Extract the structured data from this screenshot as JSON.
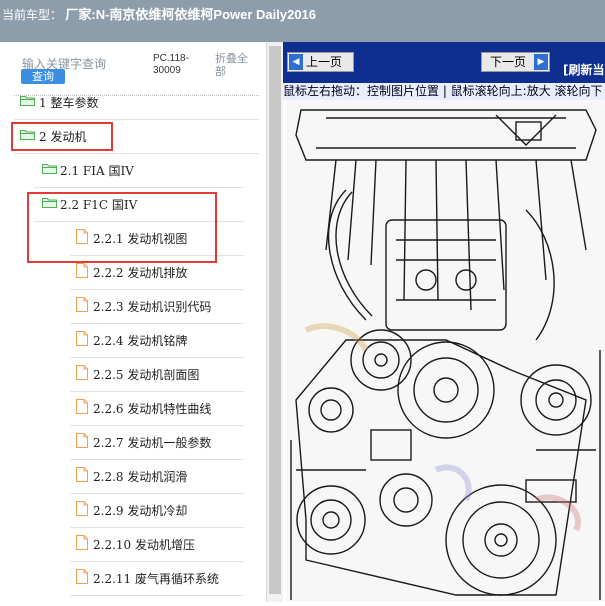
{
  "header": {
    "label": "当前车型：",
    "vehicle": "厂家:N-南京依维柯依维柯Power Daily2016"
  },
  "sidebar": {
    "search": {
      "label": "输入关键字查询",
      "button": "查询"
    },
    "pc_code": "PC.118-30009",
    "collapse_all": "折叠全部",
    "items": [
      {
        "label": "1 整车参数",
        "icon": "folder-open-icon"
      },
      {
        "label": "2 发动机",
        "icon": "folder-open-icon"
      },
      {
        "label": "2.1 FIA 国IV",
        "icon": "folder-open-icon"
      },
      {
        "label": "2.2 F1C 国IV",
        "icon": "folder-open-icon"
      },
      {
        "label": "2.2.1 发动机视图",
        "icon": "document-icon"
      },
      {
        "label": "2.2.2 发动机排放",
        "icon": "document-icon"
      },
      {
        "label": "2.2.3 发动机识别代码",
        "icon": "document-icon"
      },
      {
        "label": "2.2.4 发动机铭牌",
        "icon": "document-icon"
      },
      {
        "label": "2.2.5 发动机剖面图",
        "icon": "document-icon"
      },
      {
        "label": "2.2.6 发动机特性曲线",
        "icon": "document-icon"
      },
      {
        "label": "2.2.7 发动机一般参数",
        "icon": "document-icon"
      },
      {
        "label": "2.2.8 发动机润滑",
        "icon": "document-icon"
      },
      {
        "label": "2.2.9 发动机冷却",
        "icon": "document-icon"
      },
      {
        "label": "2.2.10 发动机增压",
        "icon": "document-icon"
      },
      {
        "label": "2.2.11 废气再循环系统",
        "icon": "document-icon"
      }
    ]
  },
  "viewer": {
    "prev_label": "上一页",
    "next_label": "下一页",
    "refresh_label": "[刷新当",
    "hint": "鼠标左右拖动：控制图片位置 | 鼠标滚轮向上:放大  滚轮向下",
    "image": "engine-line-drawing"
  },
  "colors": {
    "title_bar": "#8e9dac",
    "nav_bar": "#0e2f8f",
    "highlight": "#e53935",
    "folder": "#4caf50",
    "document": "#f0a050"
  }
}
